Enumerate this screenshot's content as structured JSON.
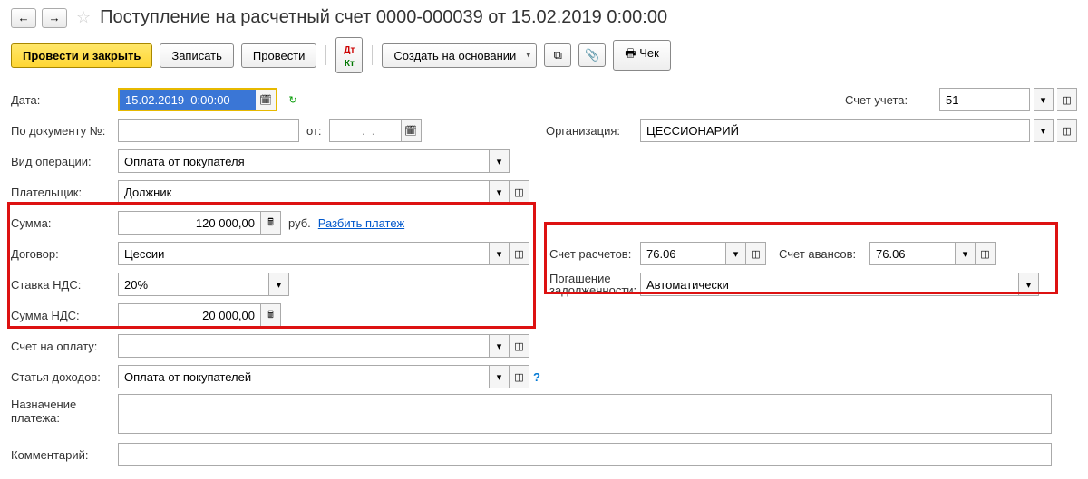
{
  "header": {
    "title": "Поступление на расчетный счет 0000-000039 от 15.02.2019 0:00:00"
  },
  "toolbar": {
    "post_close": "Провести и закрыть",
    "save": "Записать",
    "post": "Провести",
    "create_based": "Создать на основании",
    "check": "Чек"
  },
  "fields": {
    "date_label": "Дата:",
    "date_value": "15.02.2019  0:00:00",
    "docnum_label": "По документу №:",
    "docnum_value": "",
    "from_label": "от:",
    "from_value": "  .  .",
    "optype_label": "Вид операции:",
    "optype_value": "Оплата от покупателя",
    "payer_label": "Плательщик:",
    "payer_value": "Должник",
    "sum_label": "Сумма:",
    "sum_value": "120 000,00",
    "currency": "руб.",
    "split_link": "Разбить платеж",
    "contract_label": "Договор:",
    "contract_value": "Цессии",
    "vatrate_label": "Ставка НДС:",
    "vatrate_value": "20%",
    "vatsum_label": "Сумма НДС:",
    "vatsum_value": "20 000,00",
    "invoice_label": "Счет на оплату:",
    "invoice_value": "",
    "income_label": "Статья доходов:",
    "income_value": "Оплата от покупателей",
    "purpose_label": "Назначение платежа:",
    "purpose_value": "",
    "comment_label": "Комментарий:",
    "comment_value": "",
    "account_label": "Счет учета:",
    "account_value": "51",
    "org_label": "Организация:",
    "org_value": "ЦЕССИОНАРИЙ",
    "acct_settle_label": "Счет расчетов:",
    "acct_settle_value": "76.06",
    "acct_advance_label": "Счет авансов:",
    "acct_advance_value": "76.06",
    "debt_label1": "Погашение",
    "debt_label2": "задолженности:",
    "debt_value": "Автоматически"
  }
}
